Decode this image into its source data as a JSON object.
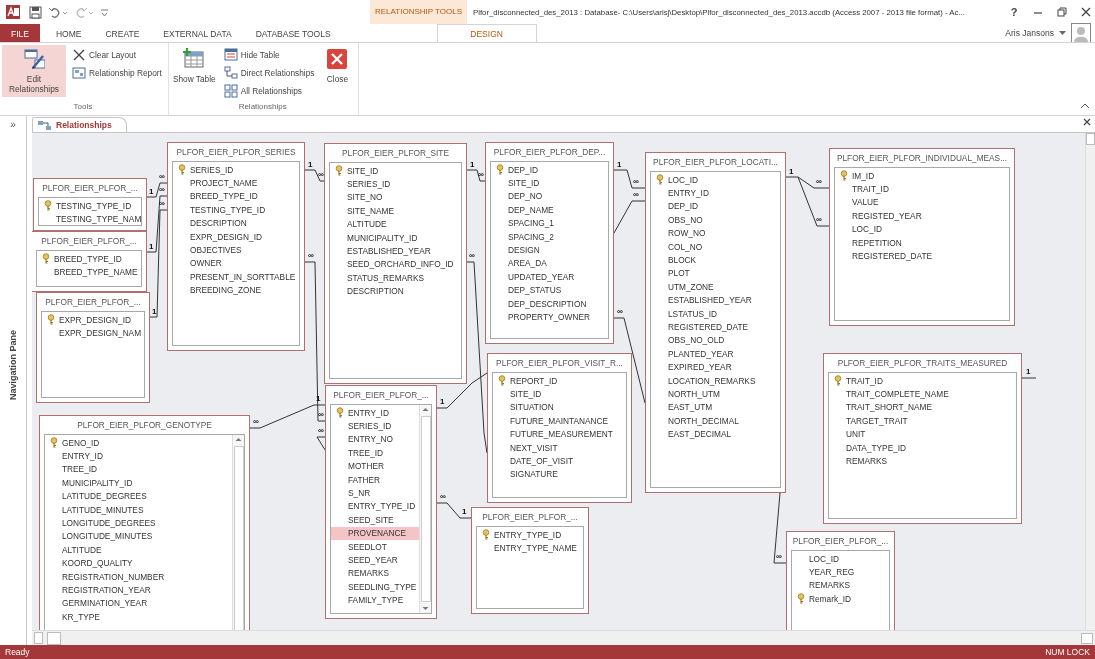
{
  "window": {
    "title": "Plfor_disconnected_des_2013 : Database- C:\\Users\\arisj\\Desktop\\Plfor_disconnected_des_2013.accdb (Access 2007 - 2013 file format) - Ac...",
    "context_label": "RELATIONSHIP TOOLS",
    "help": "?",
    "user": "Aris Jansons"
  },
  "tabs": [
    {
      "label": "FILE",
      "selected": false,
      "kind": "file"
    },
    {
      "label": "HOME",
      "selected": false,
      "kind": "tab"
    },
    {
      "label": "CREATE",
      "selected": false,
      "kind": "tab"
    },
    {
      "label": "EXTERNAL DATA",
      "selected": false,
      "kind": "tab"
    },
    {
      "label": "DATABASE TOOLS",
      "selected": false,
      "kind": "tab"
    },
    {
      "label": "DESIGN",
      "selected": true,
      "kind": "context"
    }
  ],
  "ribbon": {
    "groups": [
      {
        "label": "Tools",
        "buttons": [
          {
            "label": "Edit Relationships",
            "kind": "large",
            "pressed": true
          },
          {
            "label": "Clear Layout",
            "kind": "small",
            "pressed": false
          },
          {
            "label": "Relationship Report",
            "kind": "small",
            "pressed": false
          }
        ]
      },
      {
        "label": "Relationships",
        "buttons": [
          {
            "label": "Show Table",
            "kind": "large",
            "pressed": false
          },
          {
            "label": "Hide Table",
            "kind": "small",
            "pressed": false
          },
          {
            "label": "Direct Relationships",
            "kind": "small",
            "pressed": false
          },
          {
            "label": "All Relationships",
            "kind": "small",
            "pressed": false
          },
          {
            "label": "Close",
            "kind": "large",
            "pressed": false
          }
        ]
      }
    ]
  },
  "nav_pane": {
    "label": "Navigation Pane",
    "toggle": "»"
  },
  "document_tab": {
    "label": "Relationships",
    "selected": true
  },
  "tables": [
    {
      "title": "PLFOR_EIER_PLFOR_...",
      "kind": "plain",
      "fields": [
        {
          "name": "TESTING_TYPE_ID",
          "key": true,
          "selected": false
        },
        {
          "name": "TESTING_TYPE_NAM",
          "key": false,
          "selected": false
        }
      ]
    },
    {
      "title": "PLFOR_EIER_PLFOR_...",
      "kind": "plain",
      "fields": [
        {
          "name": "BREED_TYPE_ID",
          "key": true,
          "selected": false
        },
        {
          "name": "BREED_TYPE_NAME",
          "key": false,
          "selected": false
        }
      ]
    },
    {
      "title": "PLFOR_EIER_PLFOR_...",
      "kind": "plain",
      "fields": [
        {
          "name": "EXPR_DESIGN_ID",
          "key": true,
          "selected": false
        },
        {
          "name": "EXPR_DESIGN_NAM",
          "key": false,
          "selected": false
        }
      ]
    },
    {
      "title": "PLFOR_EIER_PLFOR_SERIES",
      "kind": "plain",
      "fields": [
        {
          "name": "SERIES_ID",
          "key": true,
          "selected": false
        },
        {
          "name": "PROJECT_NAME",
          "key": false,
          "selected": false
        },
        {
          "name": "BREED_TYPE_ID",
          "key": false,
          "selected": false
        },
        {
          "name": "TESTING_TYPE_ID",
          "key": false,
          "selected": false
        },
        {
          "name": "DESCRIPTION",
          "key": false,
          "selected": false
        },
        {
          "name": "EXPR_DESIGN_ID",
          "key": false,
          "selected": false
        },
        {
          "name": "OBJECTIVES",
          "key": false,
          "selected": false
        },
        {
          "name": "OWNER",
          "key": false,
          "selected": false
        },
        {
          "name": "PRESENT_IN_SORTTABLE",
          "key": false,
          "selected": false
        },
        {
          "name": "BREEDING_ZONE",
          "key": false,
          "selected": false
        }
      ]
    },
    {
      "title": "PLFOR_EIER_PLFOR_SITE",
      "kind": "plain",
      "fields": [
        {
          "name": "SITE_ID",
          "key": true,
          "selected": false
        },
        {
          "name": "SERIES_ID",
          "key": false,
          "selected": false
        },
        {
          "name": "SITE_NO",
          "key": false,
          "selected": false
        },
        {
          "name": "SITE_NAME",
          "key": false,
          "selected": false
        },
        {
          "name": "ALTITUDE",
          "key": false,
          "selected": false
        },
        {
          "name": "MUNICIPALITY_ID",
          "key": false,
          "selected": false
        },
        {
          "name": "ESTABLISHED_YEAR",
          "key": false,
          "selected": false
        },
        {
          "name": "SEED_ORCHARD_INFO_ID",
          "key": false,
          "selected": false
        },
        {
          "name": "STATUS_REMARKS",
          "key": false,
          "selected": false
        },
        {
          "name": "DESCRIPTION",
          "key": false,
          "selected": false
        }
      ]
    },
    {
      "title": "PLFOR_EIER_PLFOR_DEP...",
      "kind": "plain",
      "fields": [
        {
          "name": "DEP_ID",
          "key": true,
          "selected": false
        },
        {
          "name": "SITE_ID",
          "key": false,
          "selected": false
        },
        {
          "name": "DEP_NO",
          "key": false,
          "selected": false
        },
        {
          "name": "DEP_NAME",
          "key": false,
          "selected": false
        },
        {
          "name": "SPACING_1",
          "key": false,
          "selected": false
        },
        {
          "name": "SPACING_2",
          "key": false,
          "selected": false
        },
        {
          "name": "DESIGN",
          "key": false,
          "selected": false
        },
        {
          "name": "AREA_DA",
          "key": false,
          "selected": false
        },
        {
          "name": "UPDATED_YEAR",
          "key": false,
          "selected": false
        },
        {
          "name": "DEP_STATUS",
          "key": false,
          "selected": false
        },
        {
          "name": "DEP_DESCRIPTION",
          "key": false,
          "selected": false
        },
        {
          "name": "PROPERTY_OWNER",
          "key": false,
          "selected": false
        }
      ]
    },
    {
      "title": "PLFOR_EIER_PLFOR_LOCATI...",
      "kind": "plain",
      "fields": [
        {
          "name": "LOC_ID",
          "key": true,
          "selected": false
        },
        {
          "name": "ENTRY_ID",
          "key": false,
          "selected": false
        },
        {
          "name": "DEP_ID",
          "key": false,
          "selected": false
        },
        {
          "name": "OBS_NO",
          "key": false,
          "selected": false
        },
        {
          "name": "ROW_NO",
          "key": false,
          "selected": false
        },
        {
          "name": "COL_NO",
          "key": false,
          "selected": false
        },
        {
          "name": "BLOCK",
          "key": false,
          "selected": false
        },
        {
          "name": "PLOT",
          "key": false,
          "selected": false
        },
        {
          "name": "UTM_ZONE",
          "key": false,
          "selected": false
        },
        {
          "name": "ESTABLISHED_YEAR",
          "key": false,
          "selected": false
        },
        {
          "name": "LSTATUS_ID",
          "key": false,
          "selected": false
        },
        {
          "name": "REGISTERED_DATE",
          "key": false,
          "selected": false
        },
        {
          "name": "OBS_NO_OLD",
          "key": false,
          "selected": false
        },
        {
          "name": "PLANTED_YEAR",
          "key": false,
          "selected": false
        },
        {
          "name": "EXPIRED_YEAR",
          "key": false,
          "selected": false
        },
        {
          "name": "LOCATION_REMARKS",
          "key": false,
          "selected": false
        },
        {
          "name": "NORTH_UTM",
          "key": false,
          "selected": false
        },
        {
          "name": "EAST_UTM",
          "key": false,
          "selected": false
        },
        {
          "name": "NORTH_DECIMAL",
          "key": false,
          "selected": false
        },
        {
          "name": "EAST_DECIMAL",
          "key": false,
          "selected": false
        }
      ]
    },
    {
      "title": "PLFOR_EIER_PLFOR_INDIVIDUAL_MEAS...",
      "kind": "plain",
      "fields": [
        {
          "name": "IM_ID",
          "key": true,
          "selected": false
        },
        {
          "name": "TRAIT_ID",
          "key": false,
          "selected": false
        },
        {
          "name": "VALUE",
          "key": false,
          "selected": false
        },
        {
          "name": "REGISTED_YEAR",
          "key": false,
          "selected": false
        },
        {
          "name": "LOC_ID",
          "key": false,
          "selected": false
        },
        {
          "name": "REPETITION",
          "key": false,
          "selected": false
        },
        {
          "name": "REGISTERED_DATE",
          "key": false,
          "selected": false
        }
      ]
    },
    {
      "title": "PLFOR_EIER_PLFOR_VISIT_R...",
      "kind": "plain",
      "fields": [
        {
          "name": "REPORT_ID",
          "key": true,
          "selected": false
        },
        {
          "name": "SITE_ID",
          "key": false,
          "selected": false
        },
        {
          "name": "SITUATION",
          "key": false,
          "selected": false
        },
        {
          "name": "FUTURE_MAINTANANCE",
          "key": false,
          "selected": false
        },
        {
          "name": "FUTURE_MEASUREMENT",
          "key": false,
          "selected": false
        },
        {
          "name": "NEXT_VISIT",
          "key": false,
          "selected": false
        },
        {
          "name": "DATE_OF_VISIT",
          "key": false,
          "selected": false
        },
        {
          "name": "SIGNATURE",
          "key": false,
          "selected": false
        }
      ]
    },
    {
      "title": "PLFOR_EIER_PLFOR_...",
      "kind": "scrolled",
      "fields": [
        {
          "name": "ENTRY_ID",
          "key": true,
          "selected": false
        },
        {
          "name": "SERIES_ID",
          "key": false,
          "selected": false
        },
        {
          "name": "ENTRY_NO",
          "key": false,
          "selected": false
        },
        {
          "name": "TREE_ID",
          "key": false,
          "selected": false
        },
        {
          "name": "MOTHER",
          "key": false,
          "selected": false
        },
        {
          "name": "FATHER",
          "key": false,
          "selected": false
        },
        {
          "name": "S_NR",
          "key": false,
          "selected": false
        },
        {
          "name": "ENTRY_TYPE_ID",
          "key": false,
          "selected": false
        },
        {
          "name": "SEED_SITE",
          "key": false,
          "selected": false
        },
        {
          "name": "PROVENANCE",
          "key": false,
          "selected": true
        },
        {
          "name": "SEEDLOT",
          "key": false,
          "selected": false
        },
        {
          "name": "SEED_YEAR",
          "key": false,
          "selected": false
        },
        {
          "name": "REMARKS",
          "key": false,
          "selected": false
        },
        {
          "name": "SEEDLING_TYPE",
          "key": false,
          "selected": false
        },
        {
          "name": "FAMILY_TYPE",
          "key": false,
          "selected": false
        }
      ]
    },
    {
      "title": "PLFOR_EIER_PLFOR_GENOTYPE",
      "kind": "scrolled_cut",
      "fields": [
        {
          "name": "GENO_ID",
          "key": true,
          "selected": false
        },
        {
          "name": "ENTRY_ID",
          "key": false,
          "selected": false
        },
        {
          "name": "TREE_ID",
          "key": false,
          "selected": false
        },
        {
          "name": "MUNICIPALITY_ID",
          "key": false,
          "selected": false
        },
        {
          "name": "LATITUDE_DEGREES",
          "key": false,
          "selected": false
        },
        {
          "name": "LATITUDE_MINUTES",
          "key": false,
          "selected": false
        },
        {
          "name": "LONGITUDE_DEGREES",
          "key": false,
          "selected": false
        },
        {
          "name": "LONGITUDE_MINUTES",
          "key": false,
          "selected": false
        },
        {
          "name": "ALTITUDE",
          "key": false,
          "selected": false
        },
        {
          "name": "KOORD_QUALITY",
          "key": false,
          "selected": false
        },
        {
          "name": "REGISTRATION_NUMBER",
          "key": false,
          "selected": false
        },
        {
          "name": "REGISTRATION_YEAR",
          "key": false,
          "selected": false
        },
        {
          "name": "GERMINATION_YEAR",
          "key": false,
          "selected": false
        },
        {
          "name": "KR_TYPE",
          "key": false,
          "selected": false
        }
      ]
    },
    {
      "title": "PLFOR_EIER_PLFOR_...",
      "kind": "plain",
      "fields": [
        {
          "name": "ENTRY_TYPE_ID",
          "key": true,
          "selected": false
        },
        {
          "name": "ENTRY_TYPE_NAME",
          "key": false,
          "selected": false
        }
      ]
    },
    {
      "title": "PLFOR_EIER_PLFOR_TRAITS_MEASURED",
      "kind": "plain",
      "fields": [
        {
          "name": "TRAIT_ID",
          "key": true,
          "selected": false
        },
        {
          "name": "TRAIT_COMPLETE_NAME",
          "key": false,
          "selected": false
        },
        {
          "name": "TRAIT_SHORT_NAME",
          "key": false,
          "selected": false
        },
        {
          "name": "TARGET_TRAIT",
          "key": false,
          "selected": false
        },
        {
          "name": "UNIT",
          "key": false,
          "selected": false
        },
        {
          "name": "DATA_TYPE_ID",
          "key": false,
          "selected": false
        },
        {
          "name": "REMARKS",
          "key": false,
          "selected": false
        }
      ]
    },
    {
      "title": "PLFOR_EIER_PLFOR_...",
      "kind": "plain",
      "fields": [
        {
          "name": "LOC_ID",
          "key": false,
          "selected": false
        },
        {
          "name": "YEAR_REG",
          "key": false,
          "selected": false
        },
        {
          "name": "REMARKS",
          "key": false,
          "selected": false
        },
        {
          "name": "Remark_ID",
          "key": true,
          "selected": false
        }
      ]
    }
  ],
  "relationships": [
    {
      "labels": [
        "1",
        "∞"
      ]
    },
    {
      "labels": [
        "1",
        "∞"
      ]
    },
    {
      "labels": [
        "1",
        "∞"
      ]
    },
    {
      "labels": [
        "1",
        "∞"
      ]
    },
    {
      "labels": [
        "∞",
        "∞"
      ]
    },
    {
      "labels": [
        "1",
        "∞"
      ]
    },
    {
      "labels": [
        "∞"
      ]
    },
    {
      "labels": [
        "1",
        "∞"
      ]
    },
    {
      "labels": [
        "∞"
      ]
    },
    {
      "labels": [
        "1",
        "∞"
      ]
    },
    {
      "labels": [
        "∞"
      ]
    },
    {
      "labels": [
        "1"
      ]
    },
    {
      "labels": [
        "∞"
      ]
    },
    {
      "labels": [
        "1"
      ]
    },
    {
      "labels": [
        "∞",
        "1"
      ]
    },
    {
      "labels": [
        "∞",
        "1"
      ]
    },
    {
      "labels": [
        "∞"
      ]
    },
    {
      "labels": [
        "∞"
      ]
    }
  ],
  "status_bar": {
    "left": "Ready",
    "right": "NUM LOCK"
  }
}
